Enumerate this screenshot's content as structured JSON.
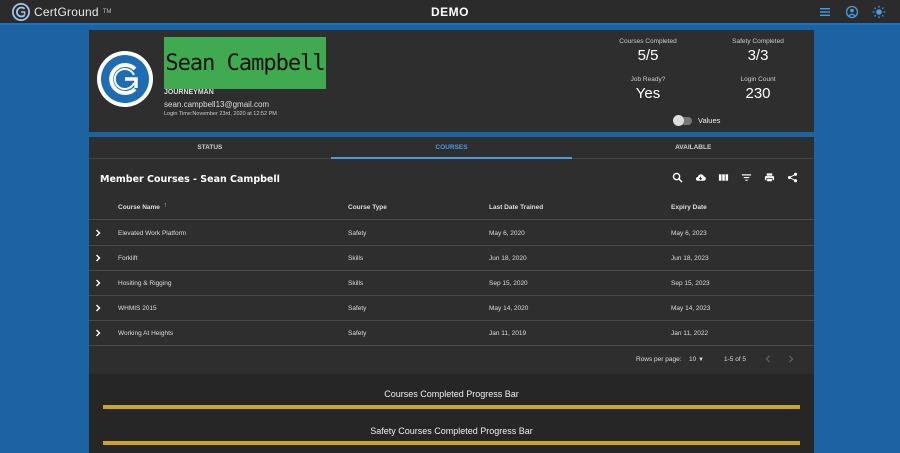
{
  "app": {
    "brand": "CertGround",
    "trademark": "TM",
    "title": "DEMO"
  },
  "header_icons": [
    "menu-icon",
    "account-icon",
    "brightness-icon"
  ],
  "profile": {
    "name": "Sean Campbell",
    "rank": "JOURNEYMAN",
    "email": "sean.campbell13@gmail.com",
    "login_time": "Login Time:November 23rd, 2020 at 12:52 PM",
    "stats": {
      "courses_completed_label": "Courses Completed",
      "courses_completed_value": "5/5",
      "safety_completed_label": "Safety Completed",
      "safety_completed_value": "3/3",
      "job_ready_label": "Job Ready?",
      "job_ready_value": "Yes",
      "login_count_label": "Login Count",
      "login_count_value": "230"
    },
    "values_toggle_label": "Values"
  },
  "tabs": [
    {
      "label": "STATUS",
      "active": false
    },
    {
      "label": "COURSES",
      "active": true
    },
    {
      "label": "AVAILABLE",
      "active": false
    }
  ],
  "table": {
    "title": "Member Courses - Sean Campbell",
    "columns": [
      "Course Name",
      "Course Type",
      "Last Date Trained",
      "Expiry Date"
    ],
    "sort_indicator": "↑",
    "rows": [
      [
        "Elevated Work Platform",
        "Safety",
        "May 6, 2020",
        "May 6, 2023"
      ],
      [
        "Forklift",
        "Skills",
        "Jun 18, 2020",
        "Jun 18, 2023"
      ],
      [
        "Hositing & Rigging",
        "Skills",
        "Sep 15, 2020",
        "Sep 15, 2023"
      ],
      [
        "WHMIS 2015",
        "Safety",
        "May 14, 2020",
        "May 14, 2023"
      ],
      [
        "Working At Heights",
        "Safety",
        "Jan 11, 2019",
        "Jan 11, 2022"
      ]
    ],
    "rows_per_page_label": "Rows per page:",
    "rows_per_page_value": "10",
    "range": "1-5 of 5"
  },
  "progress": {
    "courses_title": "Courses Completed Progress Bar",
    "courses_fraction": 1.0,
    "safety_title": "Safety Courses Completed Progress Bar",
    "safety_fraction": 1.0
  },
  "colors": {
    "background": "#1c63a3",
    "panel": "#2e2e2e",
    "accent": "#4a9be6",
    "name_highlight": "#3faa50",
    "progress": "#c9a52a"
  }
}
